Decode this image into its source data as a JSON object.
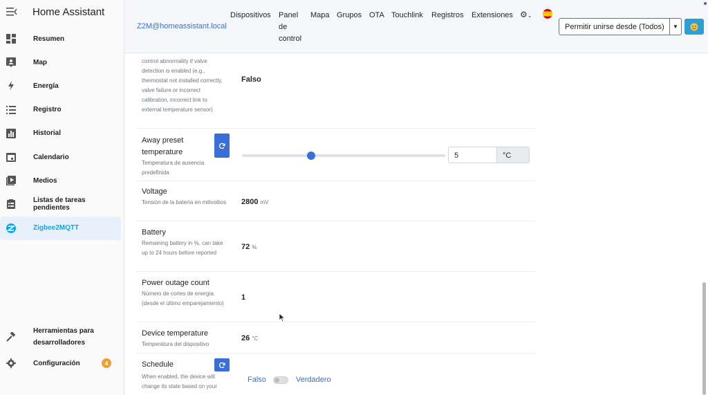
{
  "app": {
    "title": "Home Assistant"
  },
  "sidebar": {
    "items": [
      {
        "label": "Resumen",
        "icon": "dashboard-icon"
      },
      {
        "label": "Map",
        "icon": "map-icon"
      },
      {
        "label": "Energía",
        "icon": "lightning-icon"
      },
      {
        "label": "Registro",
        "icon": "list-icon"
      },
      {
        "label": "Historial",
        "icon": "chart-icon"
      },
      {
        "label": "Calendario",
        "icon": "calendar-icon"
      },
      {
        "label": "Medios",
        "icon": "media-icon"
      },
      {
        "label": "Listas de tareas pendientes",
        "icon": "clipboard-icon"
      },
      {
        "label": "Zigbee2MQTT",
        "icon": "zigbee-icon",
        "active": true
      }
    ],
    "bottom": [
      {
        "label": "Herramientas para desarrolladores",
        "icon": "hammer-icon"
      },
      {
        "label": "Configuración",
        "icon": "gear-icon",
        "badge": "4"
      }
    ]
  },
  "topbar": {
    "host": "Z2M@homeassistant.local",
    "nav": [
      "Dispositivos",
      "Panel de control",
      "Mapa",
      "Grupos",
      "OTA",
      "Touchlink",
      "Registros",
      "Extensiones"
    ],
    "join_button": "Permitir unirse desde (Todos)"
  },
  "rows": {
    "valve": {
      "desc": "control abnormality if valve detection is enabled (e.g., thermostat not installed correctly, valve failure or incorrect calibration, incorrect link to external temperature sensor)",
      "value": "Falso"
    },
    "away": {
      "name": "Away preset temperature",
      "desc": "Temperatura de ausencia predefinida",
      "value": "5",
      "unit": "°C",
      "slider_fraction": 0.34
    },
    "voltage": {
      "name": "Voltage",
      "desc": "Tensión de la batería en milivoltios",
      "value": "2800",
      "unit": "mV"
    },
    "battery": {
      "name": "Battery",
      "desc": "Remaining battery in %, can take up to 24 hours before reported",
      "value": "72",
      "unit": "%"
    },
    "outage": {
      "name": "Power outage count",
      "desc": "Número de cortes de energía (desde el último emparejamiento)",
      "value": "1"
    },
    "device_temp": {
      "name": "Device temperature",
      "desc": "Temperatura del dispositivo",
      "value": "26",
      "unit": "°C"
    },
    "schedule": {
      "name": "Schedule",
      "desc": "When enabled, the device will change its state based on your",
      "false_label": "Falso",
      "true_label": "Verdadero"
    }
  },
  "colors": {
    "accent": "#03a9f4",
    "primary": "#3b6fd8",
    "badge": "#f0a030"
  }
}
